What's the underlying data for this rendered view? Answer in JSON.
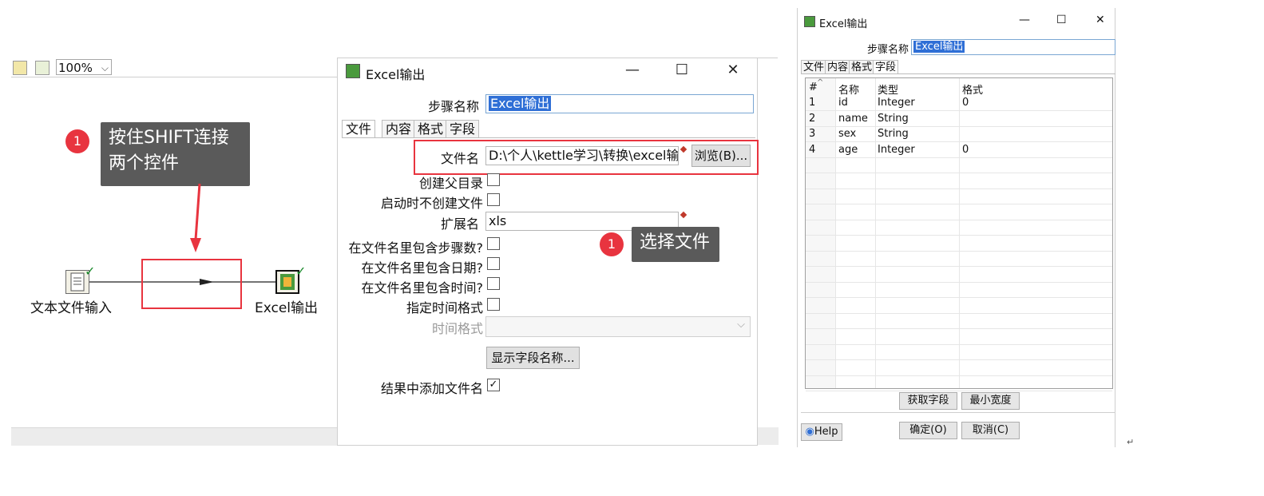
{
  "canvas": {
    "zoom": "100%",
    "callout_shift": "按住SHIFT连接\n两个控件",
    "badge_1": "1",
    "step_text_input": "文本文件输入",
    "step_excel_output": "Excel输出"
  },
  "dialog": {
    "title": "Excel输出",
    "minimize": "—",
    "maximize": "☐",
    "close": "✕",
    "step_name_label": "步骤名称",
    "step_name_value": "Excel输出",
    "tabs": [
      "文件",
      "内容",
      "格式",
      "字段"
    ],
    "filename_label": "文件名",
    "filename_value": "D:\\个人\\kettle学习\\转换\\excel输",
    "browse_button": "浏览(B)...",
    "create_parent_label": "创建父目录",
    "no_create_on_start_label": "启动时不创建文件",
    "extension_label": "扩展名",
    "extension_value": "xls",
    "include_stepnr_label": "在文件名里包含步骤数?",
    "include_date_label": "在文件名里包含日期?",
    "include_time_label": "在文件名里包含时间?",
    "specify_time_format_label": "指定时间格式",
    "time_format_label": "时间格式",
    "show_fields_button": "显示字段名称...",
    "add_to_result_label": "结果中添加文件名",
    "add_to_result_checked": "✓",
    "callout_select_file": "选择文件",
    "badge_1": "1"
  },
  "dialog2": {
    "title": "Excel输出",
    "minimize": "—",
    "maximize": "☐",
    "close": "✕",
    "step_name_label": "步骤名称",
    "step_name_value": "Excel输出",
    "tabs": [
      "文件",
      "内容",
      "格式",
      "字段"
    ],
    "columns": [
      "#",
      "名称",
      "类型",
      "格式"
    ],
    "sort_indicator": "^",
    "rows": [
      {
        "n": "1",
        "name": "id",
        "type": "Integer",
        "format": "0"
      },
      {
        "n": "2",
        "name": "name",
        "type": "String",
        "format": ""
      },
      {
        "n": "3",
        "name": "sex",
        "type": "String",
        "format": ""
      },
      {
        "n": "4",
        "name": "age",
        "type": "Integer",
        "format": "0"
      }
    ],
    "get_fields_button": "获取字段",
    "min_width_button": "最小宽度",
    "help_button": "Help",
    "ok_button": "确定(O)",
    "cancel_button": "取消(C)",
    "return_mark": "↵"
  },
  "colors": {
    "annotation_red": "#e8343f",
    "callout_bg": "#5a5a5a",
    "selection_blue": "#2f6fd6"
  }
}
